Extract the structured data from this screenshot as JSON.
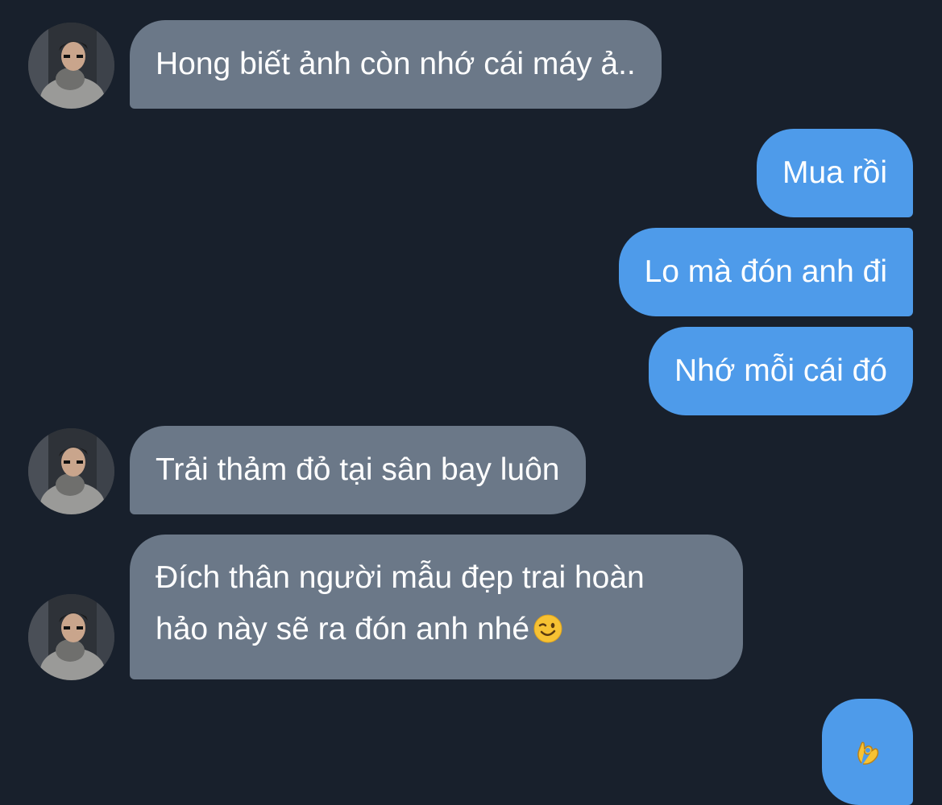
{
  "conversation": {
    "messages": [
      {
        "sender": "other",
        "text": "Hong biết ảnh còn nhớ cái máy ả.."
      },
      {
        "sender": "me",
        "text": "Mua rồi"
      },
      {
        "sender": "me",
        "text": "Lo mà đón anh đi"
      },
      {
        "sender": "me",
        "text": "Nhớ mỗi cái đó"
      },
      {
        "sender": "other",
        "text": "Trải thảm đỏ tại sân bay luôn"
      },
      {
        "sender": "other",
        "text_line1": "Đích thân người mẫu đẹp trai hoàn",
        "text_line2": "hảo này sẽ ra đón anh nhé",
        "emoji": "winking-face-emoji"
      },
      {
        "sender": "me",
        "emoji": "ok-hand-emoji"
      }
    ]
  },
  "colors": {
    "background": "#18202c",
    "incoming_bubble": "#6b7888",
    "outgoing_bubble": "#4e9bea",
    "text": "#ffffff"
  }
}
